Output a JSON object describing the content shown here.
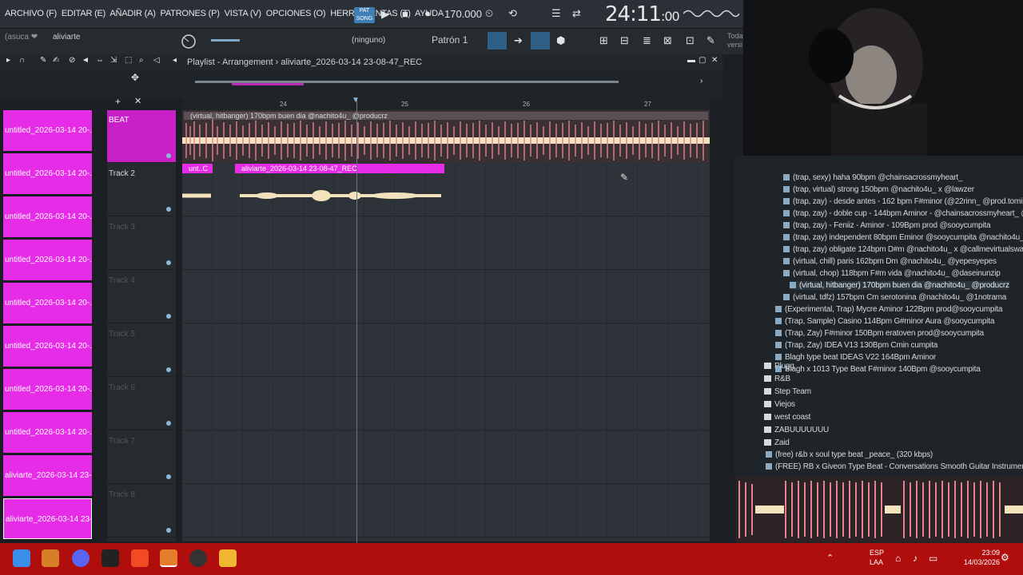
{
  "menu": [
    "ARCHIVO (F)",
    "EDITAR (E)",
    "AÑADIR (A)",
    "PATRONES (P)",
    "VISTA (V)",
    "OPCIONES (O)",
    "HERRAMIENTAS (T)",
    "AYUDA"
  ],
  "transport": {
    "mode": "SONG",
    "bpm": "170.000",
    "time_main": "24:11",
    "time_sub": ":00",
    "time_unit": "B:S:T"
  },
  "toolbar": {
    "hint": "(asuca ❤",
    "name": "aliviarte",
    "pattern_sel": "(ninguno)",
    "pattern": "Patrón 1",
    "today_label": "Today",
    "today_sub": "versi"
  },
  "playlist": {
    "title": "Playlist - Arrangement",
    "song": "aliviarte_2026-03-14 23-08-47_REC",
    "ruler": [
      "24",
      "25",
      "26",
      "27"
    ]
  },
  "clips": [
    "untitled_2026-03-14 20-...",
    "untitled_2026-03-14 20-...",
    "untitled_2026-03-14 20-...",
    "untitled_2026-03-14 20-...",
    "untitled_2026-03-14 20-...",
    "untitled_2026-03-14 20-...",
    "untitled_2026-03-14 20-...",
    "untitled_2026-03-14 20-...",
    "aliviarte_2026-03-14 23-...",
    "aliviarte_2026-03-14 23-..."
  ],
  "tracks": [
    "BEAT",
    "Track 2",
    "Track 3",
    "Track 4",
    "Track 5",
    "Track 6",
    "Track 7",
    "Track 8"
  ],
  "arrange": {
    "beat_label": "(virtual, hitbanger) 170bpm buen dia @nachito4u_ @producrz",
    "vocal1": "unt..C",
    "vocal2": "aliviarte_2026-03-14 23-08-47_REC"
  },
  "browser": {
    "items": [
      "(trap, sexy) haha 90bpm @chainsacrossmyheart_",
      "(trap, virtual) strong 150bpm @nachito4u_ x @lawzer",
      "(trap, zay) - desde antes - 162 bpm F#minor (@22rinn_ @prod.tomiii)",
      "(trap, zay) - doble cup - 144bpm Aminor - @chainsacrossmyheart_ @sooycumpita",
      "(trap, zay) - Feniiz - Aminor - 109Bpm prod @sooycumpita",
      "(trap, zay) independent 80bpm Eminor @sooycumpita @nachito4u_",
      "(trap, zay) obligate 124bpm D#m @nachito4u_ x @callmevirtualswag",
      "(virtual, chill) paris 162bpm Dm @nachito4u_ @yepesyepes",
      "(virtual, chop) 118bpm F#m vida @nachito4u_ @daseinunzip",
      "(virtual, hitbanger) 170bpm buen dia @nachito4u_ @producrz",
      "(virtual, tdfz) 157bpm Cm serotonina @nachito4u_ @1notrama",
      "(Experimental, Trap) Mycre Aminor 122Bpm prod@sooycumpita",
      "(Trap, Sample) Casino 114Bpm G#minor Aura @sooycumpita",
      "(Trap, Zay) F#minor 150Bpm eratoven prod@sooycumpita",
      "(Trap, Zay) IDEA V13 130Bpm Cmin cumpita",
      "Blagh type beat IDEAS V22 164Bpm Aminor",
      "Blagh x 1013 Type Beat F#minor 140Bpm @sooycumpita"
    ],
    "folders": [
      "Plugg",
      "R&B",
      "Step Team",
      "Viejos",
      "west coast",
      "ZABUUUUUUU",
      "Zaid"
    ],
    "files": [
      "(free) r&b x soul type beat _peace_ (320 kbps)",
      "(FREE) RB x Giveon Type Beat - Conversations  Smooth Guitar Instrumental"
    ]
  },
  "taskbar": {
    "lang1": "ESP",
    "lang2": "LAA",
    "time": "23:09",
    "date": "14/03/2026"
  }
}
